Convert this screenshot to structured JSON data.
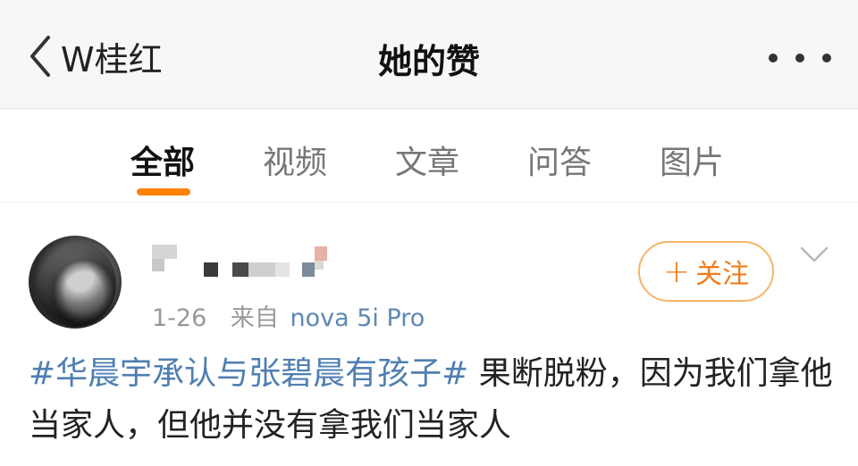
{
  "nav": {
    "back_label": "W桂红",
    "title": "她的赞"
  },
  "tabs": [
    {
      "label": "全部",
      "active": true
    },
    {
      "label": "视频",
      "active": false
    },
    {
      "label": "文章",
      "active": false
    },
    {
      "label": "问答",
      "active": false
    },
    {
      "label": "图片",
      "active": false
    }
  ],
  "post": {
    "time": "1-26",
    "source_prefix": "来自",
    "device": "nova 5i Pro",
    "follow_label": "关注",
    "hashtag": "#华晨宇承认与张碧晨有孩子#",
    "text": " 果断脱粉，因为我们拿他当家人，但他并没有拿我们当家人"
  },
  "colors": {
    "accent": "#ff8200",
    "link": "#4f7fb2",
    "follow": "#f07c1c"
  }
}
